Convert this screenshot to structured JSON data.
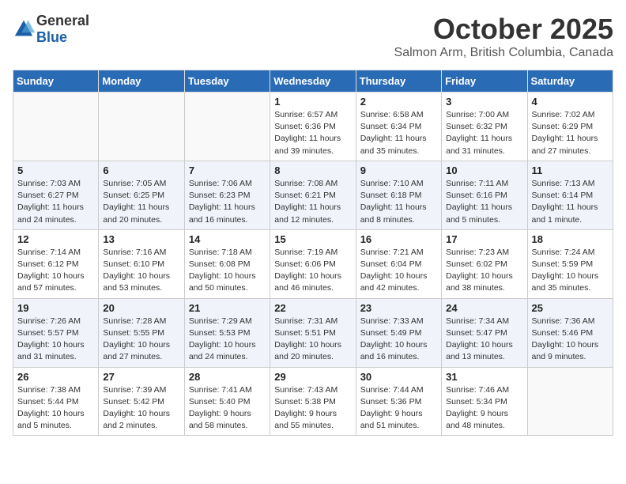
{
  "header": {
    "logo_general": "General",
    "logo_blue": "Blue",
    "month": "October 2025",
    "location": "Salmon Arm, British Columbia, Canada"
  },
  "weekdays": [
    "Sunday",
    "Monday",
    "Tuesday",
    "Wednesday",
    "Thursday",
    "Friday",
    "Saturday"
  ],
  "weeks": [
    [
      {
        "day": "",
        "info": ""
      },
      {
        "day": "",
        "info": ""
      },
      {
        "day": "",
        "info": ""
      },
      {
        "day": "1",
        "info": "Sunrise: 6:57 AM\nSunset: 6:36 PM\nDaylight: 11 hours\nand 39 minutes."
      },
      {
        "day": "2",
        "info": "Sunrise: 6:58 AM\nSunset: 6:34 PM\nDaylight: 11 hours\nand 35 minutes."
      },
      {
        "day": "3",
        "info": "Sunrise: 7:00 AM\nSunset: 6:32 PM\nDaylight: 11 hours\nand 31 minutes."
      },
      {
        "day": "4",
        "info": "Sunrise: 7:02 AM\nSunset: 6:29 PM\nDaylight: 11 hours\nand 27 minutes."
      }
    ],
    [
      {
        "day": "5",
        "info": "Sunrise: 7:03 AM\nSunset: 6:27 PM\nDaylight: 11 hours\nand 24 minutes."
      },
      {
        "day": "6",
        "info": "Sunrise: 7:05 AM\nSunset: 6:25 PM\nDaylight: 11 hours\nand 20 minutes."
      },
      {
        "day": "7",
        "info": "Sunrise: 7:06 AM\nSunset: 6:23 PM\nDaylight: 11 hours\nand 16 minutes."
      },
      {
        "day": "8",
        "info": "Sunrise: 7:08 AM\nSunset: 6:21 PM\nDaylight: 11 hours\nand 12 minutes."
      },
      {
        "day": "9",
        "info": "Sunrise: 7:10 AM\nSunset: 6:18 PM\nDaylight: 11 hours\nand 8 minutes."
      },
      {
        "day": "10",
        "info": "Sunrise: 7:11 AM\nSunset: 6:16 PM\nDaylight: 11 hours\nand 5 minutes."
      },
      {
        "day": "11",
        "info": "Sunrise: 7:13 AM\nSunset: 6:14 PM\nDaylight: 11 hours\nand 1 minute."
      }
    ],
    [
      {
        "day": "12",
        "info": "Sunrise: 7:14 AM\nSunset: 6:12 PM\nDaylight: 10 hours\nand 57 minutes."
      },
      {
        "day": "13",
        "info": "Sunrise: 7:16 AM\nSunset: 6:10 PM\nDaylight: 10 hours\nand 53 minutes."
      },
      {
        "day": "14",
        "info": "Sunrise: 7:18 AM\nSunset: 6:08 PM\nDaylight: 10 hours\nand 50 minutes."
      },
      {
        "day": "15",
        "info": "Sunrise: 7:19 AM\nSunset: 6:06 PM\nDaylight: 10 hours\nand 46 minutes."
      },
      {
        "day": "16",
        "info": "Sunrise: 7:21 AM\nSunset: 6:04 PM\nDaylight: 10 hours\nand 42 minutes."
      },
      {
        "day": "17",
        "info": "Sunrise: 7:23 AM\nSunset: 6:02 PM\nDaylight: 10 hours\nand 38 minutes."
      },
      {
        "day": "18",
        "info": "Sunrise: 7:24 AM\nSunset: 5:59 PM\nDaylight: 10 hours\nand 35 minutes."
      }
    ],
    [
      {
        "day": "19",
        "info": "Sunrise: 7:26 AM\nSunset: 5:57 PM\nDaylight: 10 hours\nand 31 minutes."
      },
      {
        "day": "20",
        "info": "Sunrise: 7:28 AM\nSunset: 5:55 PM\nDaylight: 10 hours\nand 27 minutes."
      },
      {
        "day": "21",
        "info": "Sunrise: 7:29 AM\nSunset: 5:53 PM\nDaylight: 10 hours\nand 24 minutes."
      },
      {
        "day": "22",
        "info": "Sunrise: 7:31 AM\nSunset: 5:51 PM\nDaylight: 10 hours\nand 20 minutes."
      },
      {
        "day": "23",
        "info": "Sunrise: 7:33 AM\nSunset: 5:49 PM\nDaylight: 10 hours\nand 16 minutes."
      },
      {
        "day": "24",
        "info": "Sunrise: 7:34 AM\nSunset: 5:47 PM\nDaylight: 10 hours\nand 13 minutes."
      },
      {
        "day": "25",
        "info": "Sunrise: 7:36 AM\nSunset: 5:46 PM\nDaylight: 10 hours\nand 9 minutes."
      }
    ],
    [
      {
        "day": "26",
        "info": "Sunrise: 7:38 AM\nSunset: 5:44 PM\nDaylight: 10 hours\nand 5 minutes."
      },
      {
        "day": "27",
        "info": "Sunrise: 7:39 AM\nSunset: 5:42 PM\nDaylight: 10 hours\nand 2 minutes."
      },
      {
        "day": "28",
        "info": "Sunrise: 7:41 AM\nSunset: 5:40 PM\nDaylight: 9 hours\nand 58 minutes."
      },
      {
        "day": "29",
        "info": "Sunrise: 7:43 AM\nSunset: 5:38 PM\nDaylight: 9 hours\nand 55 minutes."
      },
      {
        "day": "30",
        "info": "Sunrise: 7:44 AM\nSunset: 5:36 PM\nDaylight: 9 hours\nand 51 minutes."
      },
      {
        "day": "31",
        "info": "Sunrise: 7:46 AM\nSunset: 5:34 PM\nDaylight: 9 hours\nand 48 minutes."
      },
      {
        "day": "",
        "info": ""
      }
    ]
  ]
}
